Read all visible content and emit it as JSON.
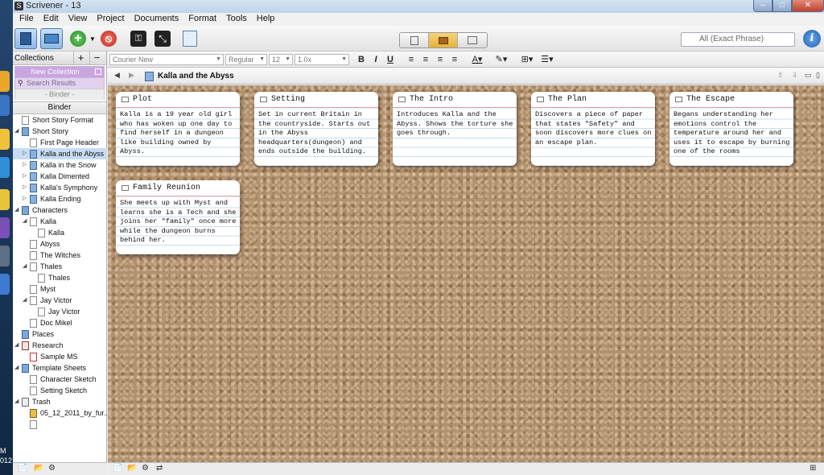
{
  "window": {
    "title": "Scrivener - 13"
  },
  "menu": [
    "File",
    "Edit",
    "View",
    "Project",
    "Documents",
    "Format",
    "Tools",
    "Help"
  ],
  "toolbar": {
    "search_placeholder": "All (Exact Phrase)"
  },
  "format_bar": {
    "font": "Courier New",
    "style": "Regular",
    "size": "12",
    "spacing": "1.0x",
    "bold": "B",
    "italic": "I",
    "underline": "U"
  },
  "sidebar": {
    "collections_label": "Collections",
    "new_collection": "New Collection",
    "search_results": "Search Results",
    "binder_tab": "- Binder -",
    "binder_header": "Binder",
    "tree": [
      {
        "label": "Short Story Format",
        "depth": 0,
        "icon": "doc-icon",
        "arrow": ""
      },
      {
        "label": "Short Story",
        "depth": 0,
        "icon": "folder-icon",
        "arrow": "◢"
      },
      {
        "label": "First Page Header",
        "depth": 1,
        "icon": "doc-icon",
        "arrow": ""
      },
      {
        "label": "Kalla and the Abyss",
        "depth": 1,
        "icon": "stack-icon",
        "arrow": "▷",
        "selected": true
      },
      {
        "label": "Kalla in the Snow",
        "depth": 1,
        "icon": "stack-icon",
        "arrow": "▷"
      },
      {
        "label": "Kalla Dimented",
        "depth": 1,
        "icon": "stack-icon",
        "arrow": "▷"
      },
      {
        "label": "Kalla's Symphony",
        "depth": 1,
        "icon": "stack-icon",
        "arrow": "▷"
      },
      {
        "label": "Kalla Ending",
        "depth": 1,
        "icon": "stack-icon",
        "arrow": "▷"
      },
      {
        "label": "Characters",
        "depth": 0,
        "icon": "folder-icon",
        "arrow": "◢"
      },
      {
        "label": "Kalla",
        "depth": 1,
        "icon": "doc-icon",
        "arrow": "◢"
      },
      {
        "label": "Kalla",
        "depth": 2,
        "icon": "doc-icon",
        "arrow": ""
      },
      {
        "label": "Abyss",
        "depth": 1,
        "icon": "doc-icon",
        "arrow": ""
      },
      {
        "label": "The Witches",
        "depth": 1,
        "icon": "doc-icon",
        "arrow": ""
      },
      {
        "label": "Thales",
        "depth": 1,
        "icon": "doc-icon",
        "arrow": "◢"
      },
      {
        "label": "Thales",
        "depth": 2,
        "icon": "doc-icon",
        "arrow": ""
      },
      {
        "label": "Myst",
        "depth": 1,
        "icon": "doc-icon",
        "arrow": ""
      },
      {
        "label": "Jay Victor",
        "depth": 1,
        "icon": "doc-icon",
        "arrow": "◢"
      },
      {
        "label": "Jay Victor",
        "depth": 2,
        "icon": "doc-icon",
        "arrow": ""
      },
      {
        "label": "Doc Mikel",
        "depth": 1,
        "icon": "doc-icon",
        "arrow": ""
      },
      {
        "label": "Places",
        "depth": 0,
        "icon": "folder-icon",
        "arrow": ""
      },
      {
        "label": "Research",
        "depth": 0,
        "icon": "research-icon",
        "arrow": "◢"
      },
      {
        "label": "Sample MS",
        "depth": 1,
        "icon": "pdf-icon",
        "arrow": ""
      },
      {
        "label": "Template Sheets",
        "depth": 0,
        "icon": "folder-icon",
        "arrow": "◢"
      },
      {
        "label": "Character Sketch",
        "depth": 1,
        "icon": "doc-icon",
        "arrow": ""
      },
      {
        "label": "Setting Sketch",
        "depth": 1,
        "icon": "doc-icon",
        "arrow": ""
      },
      {
        "label": "Trash",
        "depth": 0,
        "icon": "trash-icon",
        "arrow": "◢"
      },
      {
        "label": "05_12_2011_by_fur...",
        "depth": 1,
        "icon": "image-icon",
        "arrow": ""
      },
      {
        "label": "",
        "depth": 1,
        "icon": "doc-icon",
        "arrow": ""
      }
    ]
  },
  "document": {
    "title": "Kalla and the Abyss"
  },
  "cards": [
    {
      "title": "Plot",
      "body": "Kalla is a 19 year old girl who has woken up one day to find herself in a dungeon like building owned by Abyss."
    },
    {
      "title": "Setting",
      "body": "Set in current Britain in the countryside. Starts out in the Abyss headquarters(dungeon) and ends outside the building."
    },
    {
      "title": "The Intro",
      "body": "Introduces Kalla and the Abyss. Shows the torture she goes through."
    },
    {
      "title": "The Plan",
      "body": "Discovers a piece of paper that states \"Safety\" and soon discovers more clues on an escape plan."
    },
    {
      "title": "The Escape",
      "body": "Begans understanding her emotions control the temperature around her and uses it to escape by burning one of the rooms"
    },
    {
      "title": "Family Reunion",
      "body": "She meets up with Myst and learns she is a Tech and she joins her \"family\" once more while the dungeon burns behind her."
    }
  ],
  "os": {
    "clock": "M\n012"
  },
  "colors": {
    "accent": "#3a679c",
    "cork": "#b1916e",
    "card_rule": "#c9dcf3",
    "card_title_rule": "#e6a0a0"
  }
}
